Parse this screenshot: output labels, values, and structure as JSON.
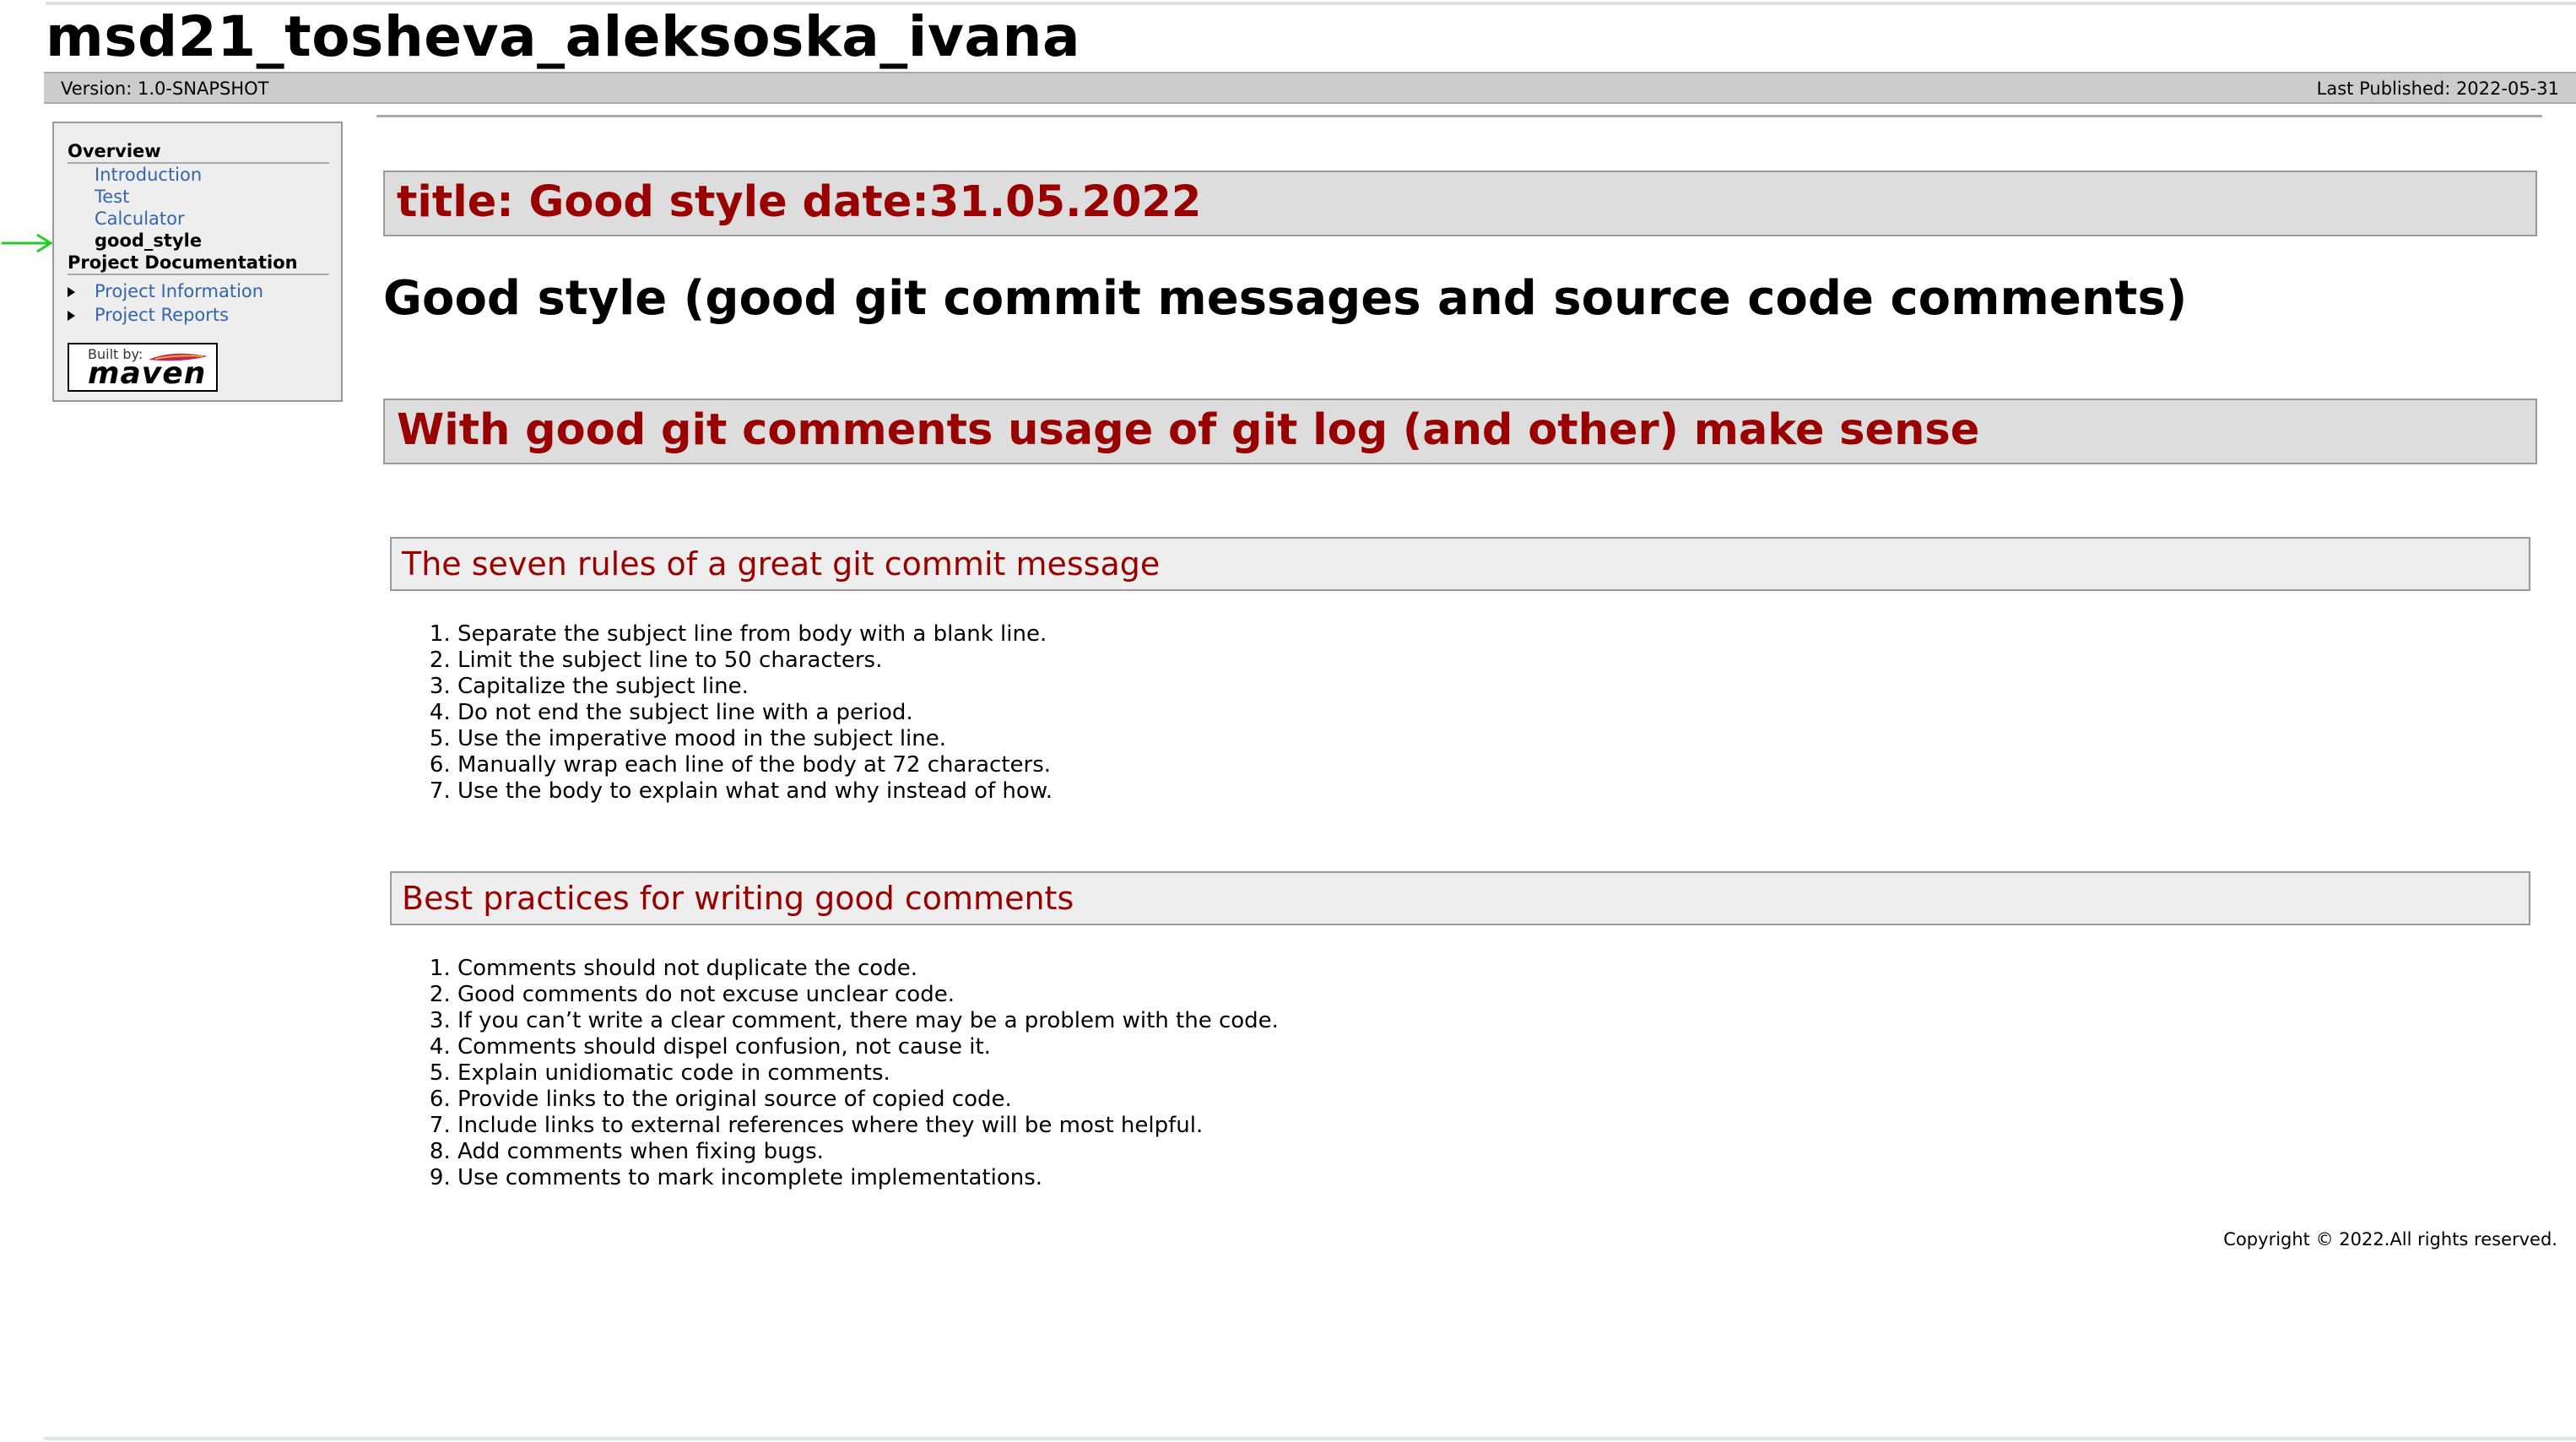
{
  "site": {
    "title": "msd21_tosheva_aleksoska_ivana"
  },
  "banner": {
    "version": "Version: 1.0-SNAPSHOT",
    "last_published": "Last Published: 2022-05-31"
  },
  "sidebar": {
    "overview_heading": "Overview",
    "items": [
      {
        "label": "Introduction"
      },
      {
        "label": "Test"
      },
      {
        "label": "Calculator"
      },
      {
        "label": "good_style"
      }
    ],
    "project_doc_heading": "Project Documentation",
    "project_items": [
      {
        "label": "Project Information"
      },
      {
        "label": "Project Reports"
      }
    ],
    "badge": {
      "built_by": "Built by:",
      "name": "maven"
    }
  },
  "main": {
    "title_box": "title: Good style date:31.05.2022",
    "page_heading": "Good style (good git commit messages and source code comments)",
    "section_heading": "With good git comments usage of git log (and other) make sense",
    "commit_rules": {
      "heading": "The seven rules of a great git commit message",
      "items": [
        "Separate the subject line from body with a blank line.",
        "Limit the subject line to 50 characters.",
        "Capitalize the subject line.",
        "Do not end the subject line with a period.",
        "Use the imperative mood in the subject line.",
        "Manually wrap each line of the body at 72 characters.",
        "Use the body to explain what and why instead of how."
      ]
    },
    "comment_practices": {
      "heading": "Best practices for writing good comments",
      "items": [
        "Comments should not duplicate the code.",
        "Good comments do not excuse unclear code.",
        "If you can’t write a clear comment, there may be a problem with the code.",
        "Comments should dispel confusion, not cause it.",
        "Explain unidiomatic code in comments.",
        "Provide links to the original source of copied code.",
        "Include links to external references where they will be most helpful.",
        "Add comments when fixing bugs.",
        "Use comments to mark incomplete implementations."
      ]
    }
  },
  "footer": {
    "copyright": "Copyright © 2022.All rights reserved."
  },
  "colors": {
    "heading_red": "#990000",
    "link_blue": "#3366aa",
    "pointer_green": "#22cc22"
  }
}
